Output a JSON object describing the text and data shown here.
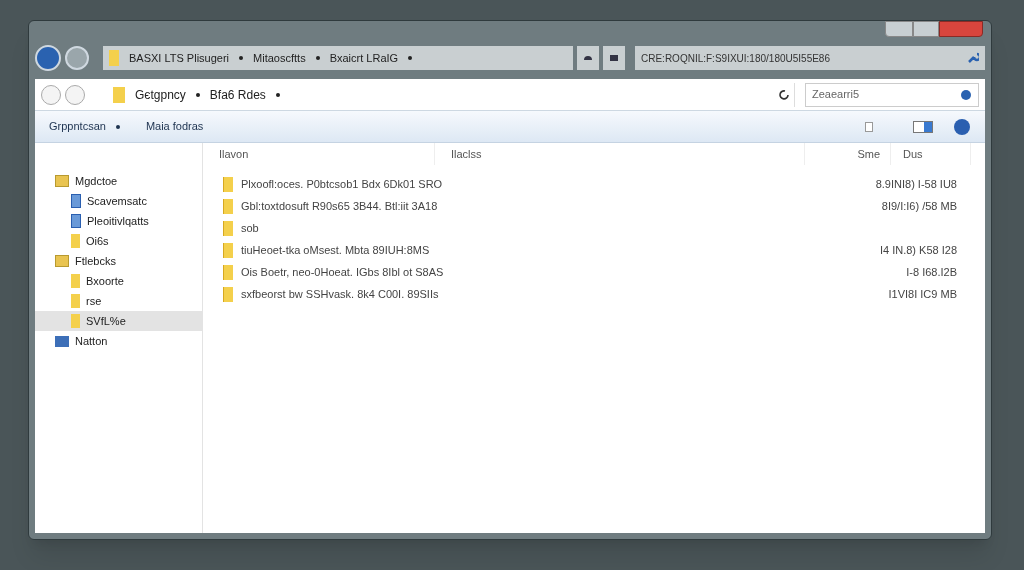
{
  "top_bar": {
    "breadcrumb": [
      "BASXI LTS Plisugeri",
      "Mitaoscftts",
      "Bxaicrt LRaIG"
    ],
    "address": "CRE:ROQNIL:F:S9IXUI:180/180U5I55E86"
  },
  "nav_bar": {
    "breadcrumb": [
      "Gєtgрncy",
      "Bfa6 Rdes"
    ],
    "search_value": "Zeaearri5"
  },
  "toolbar": {
    "items": [
      "Grppntcsan",
      "Maia fodras"
    ]
  },
  "sidebar": {
    "items": [
      {
        "label": "Mgdctoe",
        "kind": "library",
        "selected": false,
        "children": [
          {
            "label": "Scavemsatc",
            "kind": "document",
            "selected": false
          },
          {
            "label": "Pleoitivlqatts",
            "kind": "document",
            "selected": false
          },
          {
            "label": "Oi6s",
            "kind": "folder",
            "selected": false
          }
        ]
      },
      {
        "label": "Ftlebcks",
        "kind": "library",
        "selected": false,
        "children": [
          {
            "label": "Bxoorte",
            "kind": "folder",
            "selected": false
          },
          {
            "label": "rse",
            "kind": "folder",
            "selected": false
          },
          {
            "label": "SVfL%e",
            "kind": "folder",
            "selected": true
          }
        ]
      },
      {
        "label": "Natton",
        "kind": "network",
        "selected": false
      }
    ]
  },
  "table": {
    "columns": [
      "Ilavon",
      "Ilaclss",
      "Sme",
      "Dus"
    ],
    "rows": [
      {
        "name": "Plxoofl:oces. P0btcsob1 Bdx 6Dk01 SRO",
        "size": "8.9INI8) I-58 IU8"
      },
      {
        "name": "Gbl:toxtdosuft R90s65 3B44. Btl:iit 3A18",
        "size": "8I9/I:I6) /58 MB"
      },
      {
        "name": "sob",
        "size": ""
      },
      {
        "name": "tiuHeoet-tka oMsest. Mbta 89IUH:8MS",
        "size": "I4 IN.8) K58 I28"
      },
      {
        "name": "Ois Boetr, neo-0Hoeat. IGbs 8Ibl ot S8AS",
        "size": "I-8 I68.I2B"
      },
      {
        "name": "sxfbeorst bw SSHvask. 8k4 C00I. 89SIIs",
        "size": "I1VI8I IC9 MB"
      }
    ]
  }
}
